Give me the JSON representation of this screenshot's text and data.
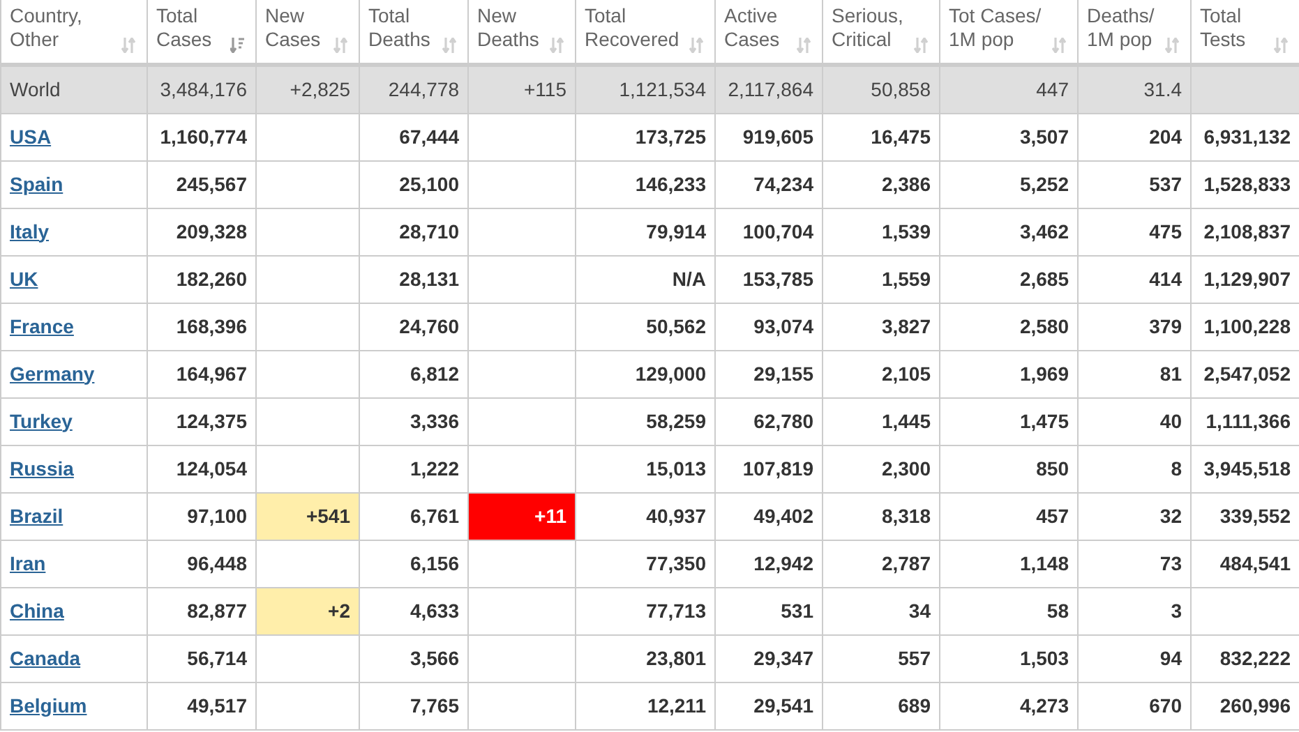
{
  "table": {
    "columns": [
      {
        "label_lines": [
          "Country,",
          "Other"
        ],
        "sorted": false
      },
      {
        "label_lines": [
          "Total",
          "Cases"
        ],
        "sorted": true
      },
      {
        "label_lines": [
          "New",
          "Cases"
        ],
        "sorted": false
      },
      {
        "label_lines": [
          "Total",
          "Deaths"
        ],
        "sorted": false
      },
      {
        "label_lines": [
          "New",
          "Deaths"
        ],
        "sorted": false
      },
      {
        "label_lines": [
          "Total",
          "Recovered"
        ],
        "sorted": false
      },
      {
        "label_lines": [
          "Active",
          "Cases"
        ],
        "sorted": false
      },
      {
        "label_lines": [
          "Serious,",
          "Critical"
        ],
        "sorted": false
      },
      {
        "label_lines": [
          "Tot Cases/",
          "1M pop"
        ],
        "sorted": false
      },
      {
        "label_lines": [
          "Deaths/",
          "1M pop"
        ],
        "sorted": false
      },
      {
        "label_lines": [
          "Total",
          "Tests"
        ],
        "sorted": false
      }
    ],
    "rows": [
      {
        "kind": "total",
        "country": "World",
        "total_cases": "3,484,176",
        "new_cases": "+2,825",
        "total_deaths": "244,778",
        "new_deaths": "+115",
        "total_recovered": "1,121,534",
        "active_cases": "2,117,864",
        "serious_critical": "50,858",
        "tot_cases_per_1m": "447",
        "deaths_per_1m": "31.4"
      },
      {
        "kind": "country",
        "country": "USA",
        "total_cases": "1,160,774",
        "total_deaths": "67,444",
        "total_recovered": "173,725",
        "active_cases": "919,605",
        "serious_critical": "16,475",
        "tot_cases_per_1m": "3,507",
        "deaths_per_1m": "204",
        "total_tests": "6,931,132"
      },
      {
        "kind": "country",
        "country": "Spain",
        "total_cases": "245,567",
        "total_deaths": "25,100",
        "total_recovered": "146,233",
        "active_cases": "74,234",
        "serious_critical": "2,386",
        "tot_cases_per_1m": "5,252",
        "deaths_per_1m": "537",
        "total_tests": "1,528,833"
      },
      {
        "kind": "country",
        "country": "Italy",
        "total_cases": "209,328",
        "total_deaths": "28,710",
        "total_recovered": "79,914",
        "active_cases": "100,704",
        "serious_critical": "1,539",
        "tot_cases_per_1m": "3,462",
        "deaths_per_1m": "475",
        "total_tests": "2,108,837"
      },
      {
        "kind": "country",
        "country": "UK",
        "total_cases": "182,260",
        "total_deaths": "28,131",
        "total_recovered": "N/A",
        "active_cases": "153,785",
        "serious_critical": "1,559",
        "tot_cases_per_1m": "2,685",
        "deaths_per_1m": "414",
        "total_tests": "1,129,907"
      },
      {
        "kind": "country",
        "country": "France",
        "total_cases": "168,396",
        "total_deaths": "24,760",
        "total_recovered": "50,562",
        "active_cases": "93,074",
        "serious_critical": "3,827",
        "tot_cases_per_1m": "2,580",
        "deaths_per_1m": "379",
        "total_tests": "1,100,228"
      },
      {
        "kind": "country",
        "country": "Germany",
        "total_cases": "164,967",
        "total_deaths": "6,812",
        "total_recovered": "129,000",
        "active_cases": "29,155",
        "serious_critical": "2,105",
        "tot_cases_per_1m": "1,969",
        "deaths_per_1m": "81",
        "total_tests": "2,547,052"
      },
      {
        "kind": "country",
        "country": "Turkey",
        "total_cases": "124,375",
        "total_deaths": "3,336",
        "total_recovered": "58,259",
        "active_cases": "62,780",
        "serious_critical": "1,445",
        "tot_cases_per_1m": "1,475",
        "deaths_per_1m": "40",
        "total_tests": "1,111,366"
      },
      {
        "kind": "country",
        "country": "Russia",
        "total_cases": "124,054",
        "total_deaths": "1,222",
        "total_recovered": "15,013",
        "active_cases": "107,819",
        "serious_critical": "2,300",
        "tot_cases_per_1m": "850",
        "deaths_per_1m": "8",
        "total_tests": "3,945,518"
      },
      {
        "kind": "country",
        "country": "Brazil",
        "total_cases": "97,100",
        "new_cases": "+541",
        "total_deaths": "6,761",
        "new_deaths": "+11",
        "total_recovered": "40,937",
        "active_cases": "49,402",
        "serious_critical": "8,318",
        "tot_cases_per_1m": "457",
        "deaths_per_1m": "32",
        "total_tests": "339,552"
      },
      {
        "kind": "country",
        "country": "Iran",
        "total_cases": "96,448",
        "total_deaths": "6,156",
        "total_recovered": "77,350",
        "active_cases": "12,942",
        "serious_critical": "2,787",
        "tot_cases_per_1m": "1,148",
        "deaths_per_1m": "73",
        "total_tests": "484,541"
      },
      {
        "kind": "country",
        "country": "China",
        "total_cases": "82,877",
        "new_cases": "+2",
        "total_deaths": "4,633",
        "total_recovered": "77,713",
        "active_cases": "531",
        "serious_critical": "34",
        "tot_cases_per_1m": "58",
        "deaths_per_1m": "3"
      },
      {
        "kind": "country",
        "country": "Canada",
        "total_cases": "56,714",
        "total_deaths": "3,566",
        "total_recovered": "23,801",
        "active_cases": "29,347",
        "serious_critical": "557",
        "tot_cases_per_1m": "1,503",
        "deaths_per_1m": "94",
        "total_tests": "832,222"
      },
      {
        "kind": "country",
        "country": "Belgium",
        "total_cases": "49,517",
        "total_deaths": "7,765",
        "total_recovered": "12,211",
        "active_cases": "29,541",
        "serious_critical": "689",
        "tot_cases_per_1m": "4,273",
        "deaths_per_1m": "670",
        "total_tests": "260,996"
      }
    ]
  }
}
